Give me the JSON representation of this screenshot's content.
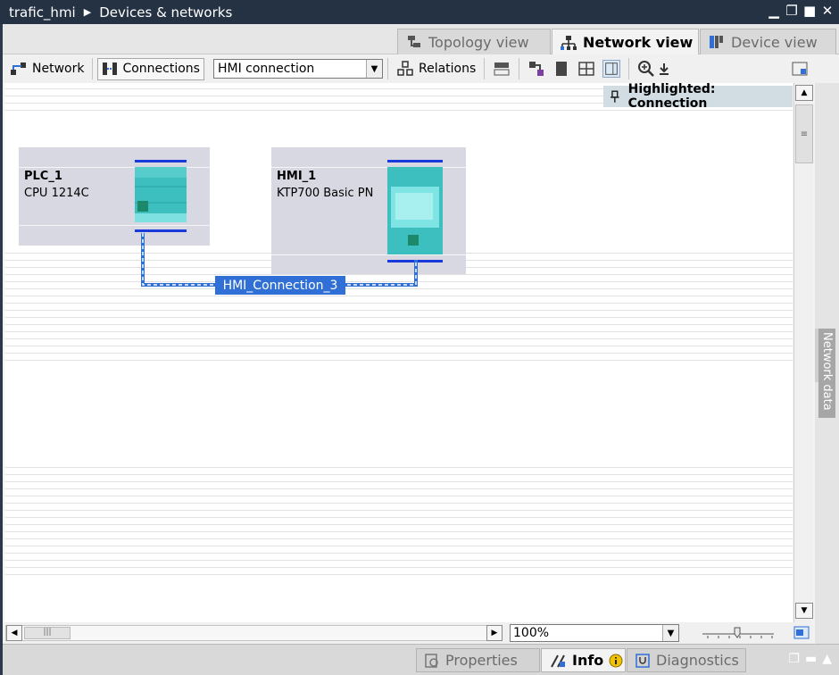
{
  "title": {
    "project": "trafic_hmi",
    "view": "Devices & networks"
  },
  "tabs": {
    "topology": "Topology view",
    "network": "Network view",
    "device": "Device view"
  },
  "toolbar": {
    "network_label": "Network",
    "connections_label": "Connections",
    "connection_type": "HMI connection",
    "relations_label": "Relations"
  },
  "canvas": {
    "highlighted": "Highlighted: Connection",
    "devices": [
      {
        "name": "PLC_1",
        "type": "CPU 1214C"
      },
      {
        "name": "HMI_1",
        "type": "KTP700 Basic PN"
      }
    ],
    "connection_label": "HMI_Connection_3"
  },
  "zoom": {
    "value": "100%"
  },
  "side_panel": {
    "label": "Network data"
  },
  "footer": {
    "properties": "Properties",
    "info": "Info",
    "diagnostics": "Diagnostics"
  },
  "colors": {
    "accent": "#2f6fd6",
    "module": "#3dbfbf",
    "device_bg": "#d8d8e2",
    "titlebar": "#243244"
  }
}
